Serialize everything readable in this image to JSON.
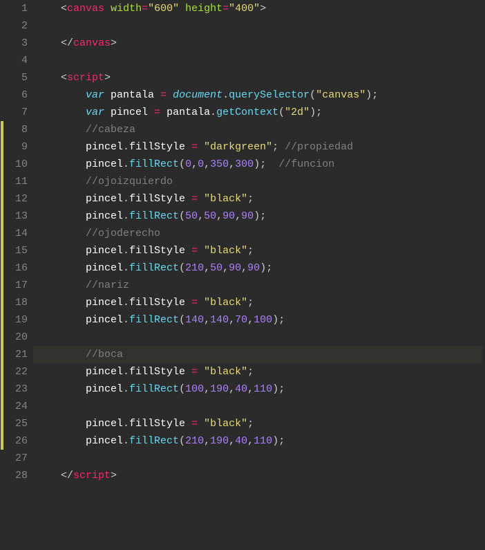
{
  "editor": {
    "totalLines": 28,
    "highlightedLine": 21,
    "changeMarkers": {
      "start": 8,
      "end": 26
    },
    "lines": {
      "l1": [
        {
          "c": "ang",
          "t": "<"
        },
        {
          "c": "tag",
          "t": "canvas"
        },
        {
          "c": "pun",
          "t": " "
        },
        {
          "c": "attr",
          "t": "width"
        },
        {
          "c": "op",
          "t": "="
        },
        {
          "c": "str",
          "t": "\"600\""
        },
        {
          "c": "pun",
          "t": " "
        },
        {
          "c": "attr",
          "t": "height"
        },
        {
          "c": "op",
          "t": "="
        },
        {
          "c": "str",
          "t": "\"400\""
        },
        {
          "c": "ang",
          "t": ">"
        }
      ],
      "l2": [],
      "l3": [
        {
          "c": "ang",
          "t": "</"
        },
        {
          "c": "tag",
          "t": "canvas"
        },
        {
          "c": "ang",
          "t": ">"
        }
      ],
      "l4": [],
      "l5": [
        {
          "c": "ang",
          "t": "<"
        },
        {
          "c": "tag",
          "t": "script"
        },
        {
          "c": "ang",
          "t": ">"
        }
      ],
      "l6": [
        {
          "c": "kw",
          "t": "var"
        },
        {
          "c": "pun",
          "t": " "
        },
        {
          "c": "ident",
          "t": "pantala"
        },
        {
          "c": "pun",
          "t": " "
        },
        {
          "c": "op",
          "t": "="
        },
        {
          "c": "pun",
          "t": " "
        },
        {
          "c": "obj",
          "t": "document"
        },
        {
          "c": "pun",
          "t": "."
        },
        {
          "c": "call",
          "t": "querySelector"
        },
        {
          "c": "pun",
          "t": "("
        },
        {
          "c": "str",
          "t": "\"canvas\""
        },
        {
          "c": "pun",
          "t": ");"
        }
      ],
      "l7": [
        {
          "c": "kw",
          "t": "var"
        },
        {
          "c": "pun",
          "t": " "
        },
        {
          "c": "ident",
          "t": "pincel"
        },
        {
          "c": "pun",
          "t": " "
        },
        {
          "c": "op",
          "t": "="
        },
        {
          "c": "pun",
          "t": " "
        },
        {
          "c": "ident",
          "t": "pantala"
        },
        {
          "c": "pun",
          "t": "."
        },
        {
          "c": "call",
          "t": "getContext"
        },
        {
          "c": "pun",
          "t": "("
        },
        {
          "c": "str",
          "t": "\"2d\""
        },
        {
          "c": "pun",
          "t": ");"
        }
      ],
      "l8": [
        {
          "c": "cmt",
          "t": "//cabeza"
        }
      ],
      "l9": [
        {
          "c": "ident",
          "t": "pincel"
        },
        {
          "c": "pun",
          "t": "."
        },
        {
          "c": "ident",
          "t": "fillStyle"
        },
        {
          "c": "pun",
          "t": " "
        },
        {
          "c": "op",
          "t": "="
        },
        {
          "c": "pun",
          "t": " "
        },
        {
          "c": "str",
          "t": "\"darkgreen\""
        },
        {
          "c": "pun",
          "t": "; "
        },
        {
          "c": "cmt",
          "t": "//propiedad"
        }
      ],
      "l10": [
        {
          "c": "ident",
          "t": "pincel"
        },
        {
          "c": "pun",
          "t": "."
        },
        {
          "c": "call",
          "t": "fillRect"
        },
        {
          "c": "pun",
          "t": "("
        },
        {
          "c": "num",
          "t": "0"
        },
        {
          "c": "pun",
          "t": ","
        },
        {
          "c": "num",
          "t": "0"
        },
        {
          "c": "pun",
          "t": ","
        },
        {
          "c": "num",
          "t": "350"
        },
        {
          "c": "pun",
          "t": ","
        },
        {
          "c": "num",
          "t": "300"
        },
        {
          "c": "pun",
          "t": ");  "
        },
        {
          "c": "cmt",
          "t": "//funcion"
        }
      ],
      "l11": [
        {
          "c": "cmt",
          "t": "//ojoizquierdo"
        }
      ],
      "l12": [
        {
          "c": "ident",
          "t": "pincel"
        },
        {
          "c": "pun",
          "t": "."
        },
        {
          "c": "ident",
          "t": "fillStyle"
        },
        {
          "c": "pun",
          "t": " "
        },
        {
          "c": "op",
          "t": "="
        },
        {
          "c": "pun",
          "t": " "
        },
        {
          "c": "str",
          "t": "\"black\""
        },
        {
          "c": "pun",
          "t": ";"
        }
      ],
      "l13": [
        {
          "c": "ident",
          "t": "pincel"
        },
        {
          "c": "pun",
          "t": "."
        },
        {
          "c": "call",
          "t": "fillRect"
        },
        {
          "c": "pun",
          "t": "("
        },
        {
          "c": "num",
          "t": "50"
        },
        {
          "c": "pun",
          "t": ","
        },
        {
          "c": "num",
          "t": "50"
        },
        {
          "c": "pun",
          "t": ","
        },
        {
          "c": "num",
          "t": "90"
        },
        {
          "c": "pun",
          "t": ","
        },
        {
          "c": "num",
          "t": "90"
        },
        {
          "c": "pun",
          "t": ");"
        }
      ],
      "l14": [
        {
          "c": "cmt",
          "t": "//ojoderecho"
        }
      ],
      "l15": [
        {
          "c": "ident",
          "t": "pincel"
        },
        {
          "c": "pun",
          "t": "."
        },
        {
          "c": "ident",
          "t": "fillStyle"
        },
        {
          "c": "pun",
          "t": " "
        },
        {
          "c": "op",
          "t": "="
        },
        {
          "c": "pun",
          "t": " "
        },
        {
          "c": "str",
          "t": "\"black\""
        },
        {
          "c": "pun",
          "t": ";"
        }
      ],
      "l16": [
        {
          "c": "ident",
          "t": "pincel"
        },
        {
          "c": "pun",
          "t": "."
        },
        {
          "c": "call",
          "t": "fillRect"
        },
        {
          "c": "pun",
          "t": "("
        },
        {
          "c": "num",
          "t": "210"
        },
        {
          "c": "pun",
          "t": ","
        },
        {
          "c": "num",
          "t": "50"
        },
        {
          "c": "pun",
          "t": ","
        },
        {
          "c": "num",
          "t": "90"
        },
        {
          "c": "pun",
          "t": ","
        },
        {
          "c": "num",
          "t": "90"
        },
        {
          "c": "pun",
          "t": ");"
        }
      ],
      "l17": [
        {
          "c": "cmt",
          "t": "//nariz"
        }
      ],
      "l18": [
        {
          "c": "ident",
          "t": "pincel"
        },
        {
          "c": "pun",
          "t": "."
        },
        {
          "c": "ident",
          "t": "fillStyle"
        },
        {
          "c": "pun",
          "t": " "
        },
        {
          "c": "op",
          "t": "="
        },
        {
          "c": "pun",
          "t": " "
        },
        {
          "c": "str",
          "t": "\"black\""
        },
        {
          "c": "pun",
          "t": ";"
        }
      ],
      "l19": [
        {
          "c": "ident",
          "t": "pincel"
        },
        {
          "c": "pun",
          "t": "."
        },
        {
          "c": "call",
          "t": "fillRect"
        },
        {
          "c": "pun",
          "t": "("
        },
        {
          "c": "num",
          "t": "140"
        },
        {
          "c": "pun",
          "t": ","
        },
        {
          "c": "num",
          "t": "140"
        },
        {
          "c": "pun",
          "t": ","
        },
        {
          "c": "num",
          "t": "70"
        },
        {
          "c": "pun",
          "t": ","
        },
        {
          "c": "num",
          "t": "100"
        },
        {
          "c": "pun",
          "t": ");"
        }
      ],
      "l20": [],
      "l21": [
        {
          "c": "cmt",
          "t": "//boca"
        }
      ],
      "l22": [
        {
          "c": "ident",
          "t": "pincel"
        },
        {
          "c": "pun",
          "t": "."
        },
        {
          "c": "ident",
          "t": "fillStyle"
        },
        {
          "c": "pun",
          "t": " "
        },
        {
          "c": "op",
          "t": "="
        },
        {
          "c": "pun",
          "t": " "
        },
        {
          "c": "str",
          "t": "\"black\""
        },
        {
          "c": "pun",
          "t": ";"
        }
      ],
      "l23": [
        {
          "c": "ident",
          "t": "pincel"
        },
        {
          "c": "pun",
          "t": "."
        },
        {
          "c": "call",
          "t": "fillRect"
        },
        {
          "c": "pun",
          "t": "("
        },
        {
          "c": "num",
          "t": "100"
        },
        {
          "c": "pun",
          "t": ","
        },
        {
          "c": "num",
          "t": "190"
        },
        {
          "c": "pun",
          "t": ","
        },
        {
          "c": "num",
          "t": "40"
        },
        {
          "c": "pun",
          "t": ","
        },
        {
          "c": "num",
          "t": "110"
        },
        {
          "c": "pun",
          "t": ");"
        }
      ],
      "l24": [],
      "l25": [
        {
          "c": "ident",
          "t": "pincel"
        },
        {
          "c": "pun",
          "t": "."
        },
        {
          "c": "ident",
          "t": "fillStyle"
        },
        {
          "c": "pun",
          "t": " "
        },
        {
          "c": "op",
          "t": "="
        },
        {
          "c": "pun",
          "t": " "
        },
        {
          "c": "str",
          "t": "\"black\""
        },
        {
          "c": "pun",
          "t": ";"
        }
      ],
      "l26": [
        {
          "c": "ident",
          "t": "pincel"
        },
        {
          "c": "pun",
          "t": "."
        },
        {
          "c": "call",
          "t": "fillRect"
        },
        {
          "c": "pun",
          "t": "("
        },
        {
          "c": "num",
          "t": "210"
        },
        {
          "c": "pun",
          "t": ","
        },
        {
          "c": "num",
          "t": "190"
        },
        {
          "c": "pun",
          "t": ","
        },
        {
          "c": "num",
          "t": "40"
        },
        {
          "c": "pun",
          "t": ","
        },
        {
          "c": "num",
          "t": "110"
        },
        {
          "c": "pun",
          "t": ");"
        }
      ],
      "l27": [],
      "l28": [
        {
          "c": "ang",
          "t": "</"
        },
        {
          "c": "tag",
          "t": "script"
        },
        {
          "c": "ang",
          "t": ">"
        }
      ]
    },
    "indents": {
      "l1": 1,
      "l2": 0,
      "l3": 1,
      "l4": 0,
      "l5": 1,
      "l6": 2,
      "l7": 2,
      "l8": 2,
      "l9": 2,
      "l10": 2,
      "l11": 2,
      "l12": 2,
      "l13": 2,
      "l14": 2,
      "l15": 2,
      "l16": 2,
      "l17": 2,
      "l18": 2,
      "l19": 2,
      "l20": 0,
      "l21": 2,
      "l22": 2,
      "l23": 2,
      "l24": 0,
      "l25": 2,
      "l26": 2,
      "l27": 0,
      "l28": 1
    }
  }
}
